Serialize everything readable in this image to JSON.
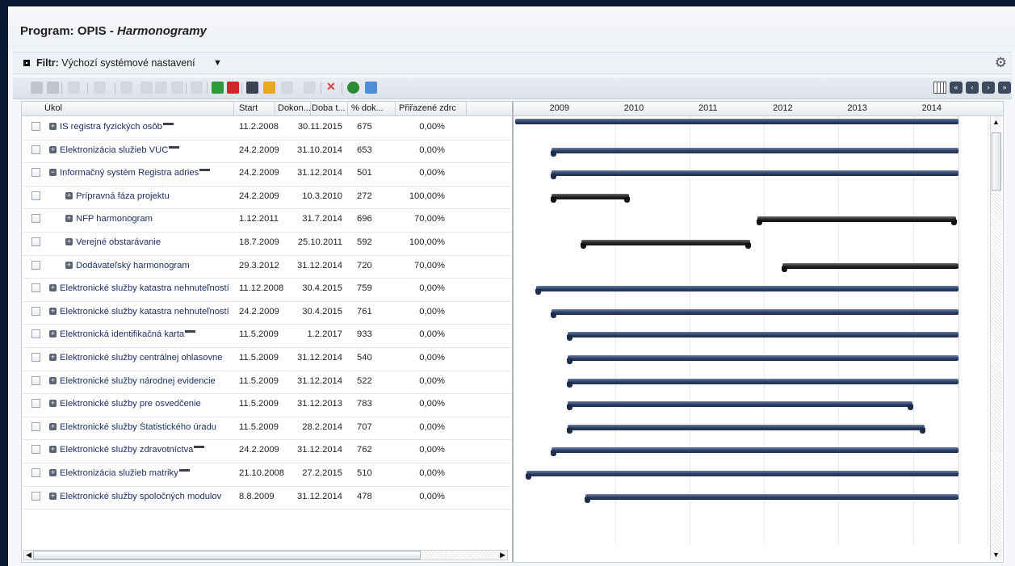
{
  "app": {
    "title_prefix": "Program: OPIS - ",
    "title_module": "Harmonogramy"
  },
  "filter": {
    "label": "Filtr:",
    "value": "Výchozí systémové nastavení"
  },
  "toolbar": {
    "icons": [
      "save-icon",
      "save-as-icon",
      "link-icon",
      "tag-icon",
      "indent-icon",
      "outdent-icon",
      "move-up-icon",
      "chain-icon",
      "unchain-icon",
      "add-icon",
      "remove-icon",
      "print-icon",
      "lock-icon",
      "filter-icon",
      "camera-icon",
      "delete-icon",
      "info-icon",
      "expand-icon"
    ],
    "nav_icons": [
      "grid-icon",
      "first-icon",
      "prev-icon",
      "next-icon",
      "last-icon"
    ]
  },
  "columns": {
    "task": "Úkol",
    "start": "Start",
    "finish": "Dokon...",
    "duration": "Doba t...",
    "percent": "% dok...",
    "resources": "Přiřazené zdrc"
  },
  "years": [
    "2009",
    "2010",
    "2011",
    "2012",
    "2013",
    "2014"
  ],
  "tasks": [
    {
      "name": "IS registra fyzických osôb",
      "icon": true,
      "indent": 0,
      "start": "11.2.2008",
      "finish": "30.11.2015",
      "duration": "675",
      "percent": "0,00%",
      "bar": "blue"
    },
    {
      "name": "Elektronizácia služieb VÚC",
      "icon": true,
      "indent": 0,
      "start": "24.2.2009",
      "finish": "31.10.2014",
      "duration": "653",
      "percent": "0,00%",
      "bar": "blue"
    },
    {
      "name": "Informačný systém Registra adries",
      "icon": true,
      "indent": 0,
      "start": "24.2.2009",
      "finish": "31.12.2014",
      "duration": "501",
      "percent": "0,00%",
      "bar": "blue",
      "expanded": true
    },
    {
      "name": "Prípravná fáza projektu",
      "icon": false,
      "indent": 1,
      "start": "24.2.2009",
      "finish": "10.3.2010",
      "duration": "272",
      "percent": "100,00%",
      "bar": "black"
    },
    {
      "name": "NFP harmonogram",
      "icon": false,
      "indent": 1,
      "start": "1.12.2011",
      "finish": "31.7.2014",
      "duration": "696",
      "percent": "70,00%",
      "bar": "black"
    },
    {
      "name": "Verejné obstarávanie",
      "icon": false,
      "indent": 1,
      "start": "18.7.2009",
      "finish": "25.10.2011",
      "duration": "592",
      "percent": "100,00%",
      "bar": "black"
    },
    {
      "name": "Dodávateľský harmonogram",
      "icon": false,
      "indent": 1,
      "start": "29.3.2012",
      "finish": "31.12.2014",
      "duration": "720",
      "percent": "70,00%",
      "bar": "black"
    },
    {
      "name": "Elektronické služby katastra nehnuteľností",
      "icon": false,
      "indent": 0,
      "start": "11.12.2008",
      "finish": "30.4.2015",
      "duration": "759",
      "percent": "0,00%",
      "bar": "blue"
    },
    {
      "name": "Elektronické služby katastra nehnuteľností",
      "icon": false,
      "indent": 0,
      "start": "24.2.2009",
      "finish": "30.4.2015",
      "duration": "761",
      "percent": "0,00%",
      "bar": "blue"
    },
    {
      "name": "Elektronická identifikačná karta",
      "icon": true,
      "indent": 0,
      "start": "11.5.2009",
      "finish": "1.2.2017",
      "duration": "933",
      "percent": "0,00%",
      "bar": "blue"
    },
    {
      "name": "Elektronické služby centrálnej ohlasovne",
      "icon": false,
      "indent": 0,
      "start": "11.5.2009",
      "finish": "31.12.2014",
      "duration": "540",
      "percent": "0,00%",
      "bar": "blue"
    },
    {
      "name": "Elektronické služby národnej evidencie",
      "icon": false,
      "indent": 0,
      "start": "11.5.2009",
      "finish": "31.12.2014",
      "duration": "522",
      "percent": "0,00%",
      "bar": "blue"
    },
    {
      "name": "Elektronické služby pre osvedčenie",
      "icon": false,
      "indent": 0,
      "start": "11.5.2009",
      "finish": "31.12.2013",
      "duration": "783",
      "percent": "0,00%",
      "bar": "blue"
    },
    {
      "name": "Elektronické služby Štatistického úradu",
      "icon": false,
      "indent": 0,
      "start": "11.5.2009",
      "finish": "28.2.2014",
      "duration": "707",
      "percent": "0,00%",
      "bar": "blue"
    },
    {
      "name": "Elektronické služby zdravotníctva",
      "icon": true,
      "indent": 0,
      "start": "24.2.2009",
      "finish": "31.12.2014",
      "duration": "762",
      "percent": "0,00%",
      "bar": "blue"
    },
    {
      "name": "Elektronizácia služieb matriky",
      "icon": true,
      "indent": 0,
      "start": "21.10.2008",
      "finish": "27.2.2015",
      "duration": "510",
      "percent": "0,00%",
      "bar": "blue"
    },
    {
      "name": "Elektronické služby spoločných modulov",
      "icon": false,
      "indent": 0,
      "start": "8.8.2009",
      "finish": "31.12.2014",
      "duration": "478",
      "percent": "0,00%",
      "bar": "blue"
    }
  ]
}
